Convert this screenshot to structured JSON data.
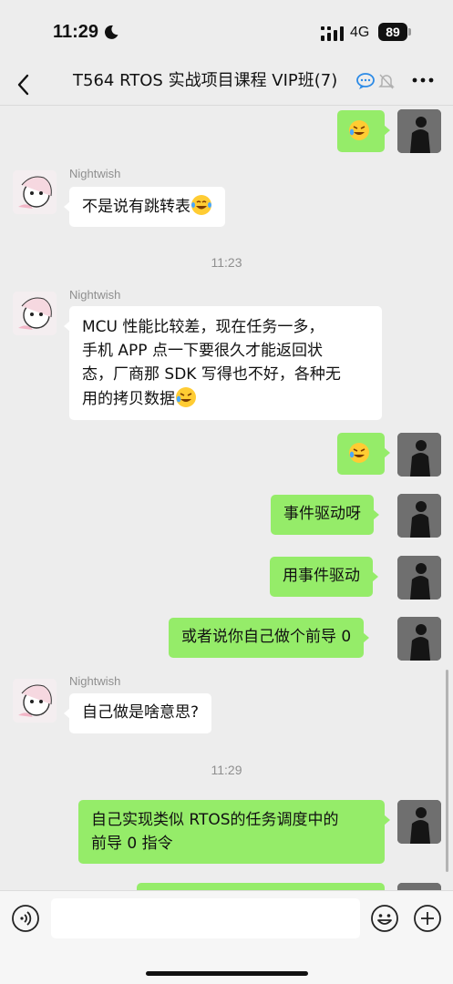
{
  "status_bar": {
    "time": "11:29",
    "network": "4G",
    "battery": "89"
  },
  "header": {
    "title": "T564 RTOS 实战项目课程 VIP班(7)"
  },
  "messages": [
    {
      "side": "out",
      "text": "",
      "emoji": "laugh-cry-emoji"
    },
    {
      "side": "in",
      "sender": "Nightwish",
      "text": "不是说有跳转表",
      "emoji": "tears-of-joy-emoji"
    },
    {
      "type": "time",
      "text": "11:23"
    },
    {
      "side": "in",
      "sender": "Nightwish",
      "lines": [
        "MCU 性能比较差，现在任务一多，",
        "手机 APP 点一下要很久才能返回状",
        "态，厂商那 SDK 写得也不好，各种无",
        "用的拷贝数据"
      ],
      "emoji": "laugh-cry-emoji"
    },
    {
      "side": "out",
      "text": "",
      "emoji": "laugh-cry-emoji"
    },
    {
      "side": "out",
      "text": "事件驱动呀"
    },
    {
      "side": "out",
      "text": "用事件驱动"
    },
    {
      "side": "out",
      "text": "或者说你自己做个前导 0"
    },
    {
      "side": "in",
      "sender": "Nightwish",
      "text": "自己做是啥意思?"
    },
    {
      "type": "time",
      "text": "11:29"
    },
    {
      "side": "out",
      "lines": [
        "自己实现类似 RTOS的任务调度中的",
        "前导 0 指令"
      ]
    }
  ],
  "input": {
    "placeholder": ""
  },
  "colors": {
    "outgoing_bubble": "#95ec69",
    "incoming_bubble": "#ffffff",
    "background": "#ededed"
  }
}
